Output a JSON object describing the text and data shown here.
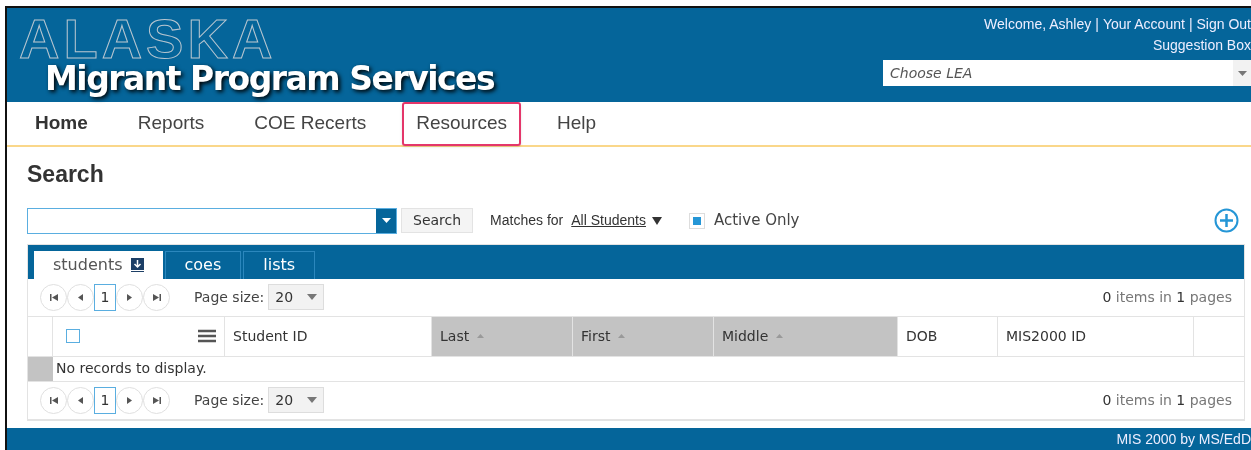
{
  "header": {
    "logo_outline": "ALASKA",
    "title": "Migrant Program Services",
    "user_links": [
      "Welcome, Ashley",
      "Your Account",
      "Sign Out"
    ],
    "separator": "|",
    "suggestion_link": "Suggestion Box",
    "lea_select": {
      "placeholder": "Choose LEA"
    }
  },
  "nav": [
    {
      "label": "Home",
      "selected": true,
      "highlighted": false
    },
    {
      "label": "Reports",
      "selected": false,
      "highlighted": false
    },
    {
      "label": "COE Recerts",
      "selected": false,
      "highlighted": false
    },
    {
      "label": "Resources",
      "selected": false,
      "highlighted": true
    },
    {
      "label": "Help",
      "selected": false,
      "highlighted": false
    }
  ],
  "page_title": "Search",
  "search": {
    "button": "Search",
    "matches_label": "Matches for",
    "matches_value": "All Students",
    "active_only": {
      "label": "Active Only",
      "checked": true
    }
  },
  "tabs": [
    {
      "label": "students",
      "selected": true,
      "download": true
    },
    {
      "label": "coes",
      "selected": false,
      "download": false
    },
    {
      "label": "lists",
      "selected": false,
      "download": false
    }
  ],
  "pager_top": {
    "page": "1",
    "page_size_label": "Page size:",
    "page_size": "20",
    "count": "0",
    "items_in": "items in",
    "pages": "1",
    "pages_label": "pages"
  },
  "table": {
    "header_checked": false,
    "columns": [
      {
        "label": "Student ID",
        "sorted": false
      },
      {
        "label": "Last",
        "sorted": true
      },
      {
        "label": "First",
        "sorted": true
      },
      {
        "label": "Middle",
        "sorted": true
      },
      {
        "label": "DOB",
        "sorted": false
      },
      {
        "label": "MIS2000 ID",
        "sorted": false
      }
    ],
    "empty_message": "No records to display."
  },
  "pager_bottom": {
    "page": "1",
    "page_size_label": "Page size:",
    "page_size": "20",
    "count": "0",
    "items_in": "items in",
    "pages": "1",
    "pages_label": "pages"
  },
  "footer": "MIS 2000 by MS/EdD"
}
